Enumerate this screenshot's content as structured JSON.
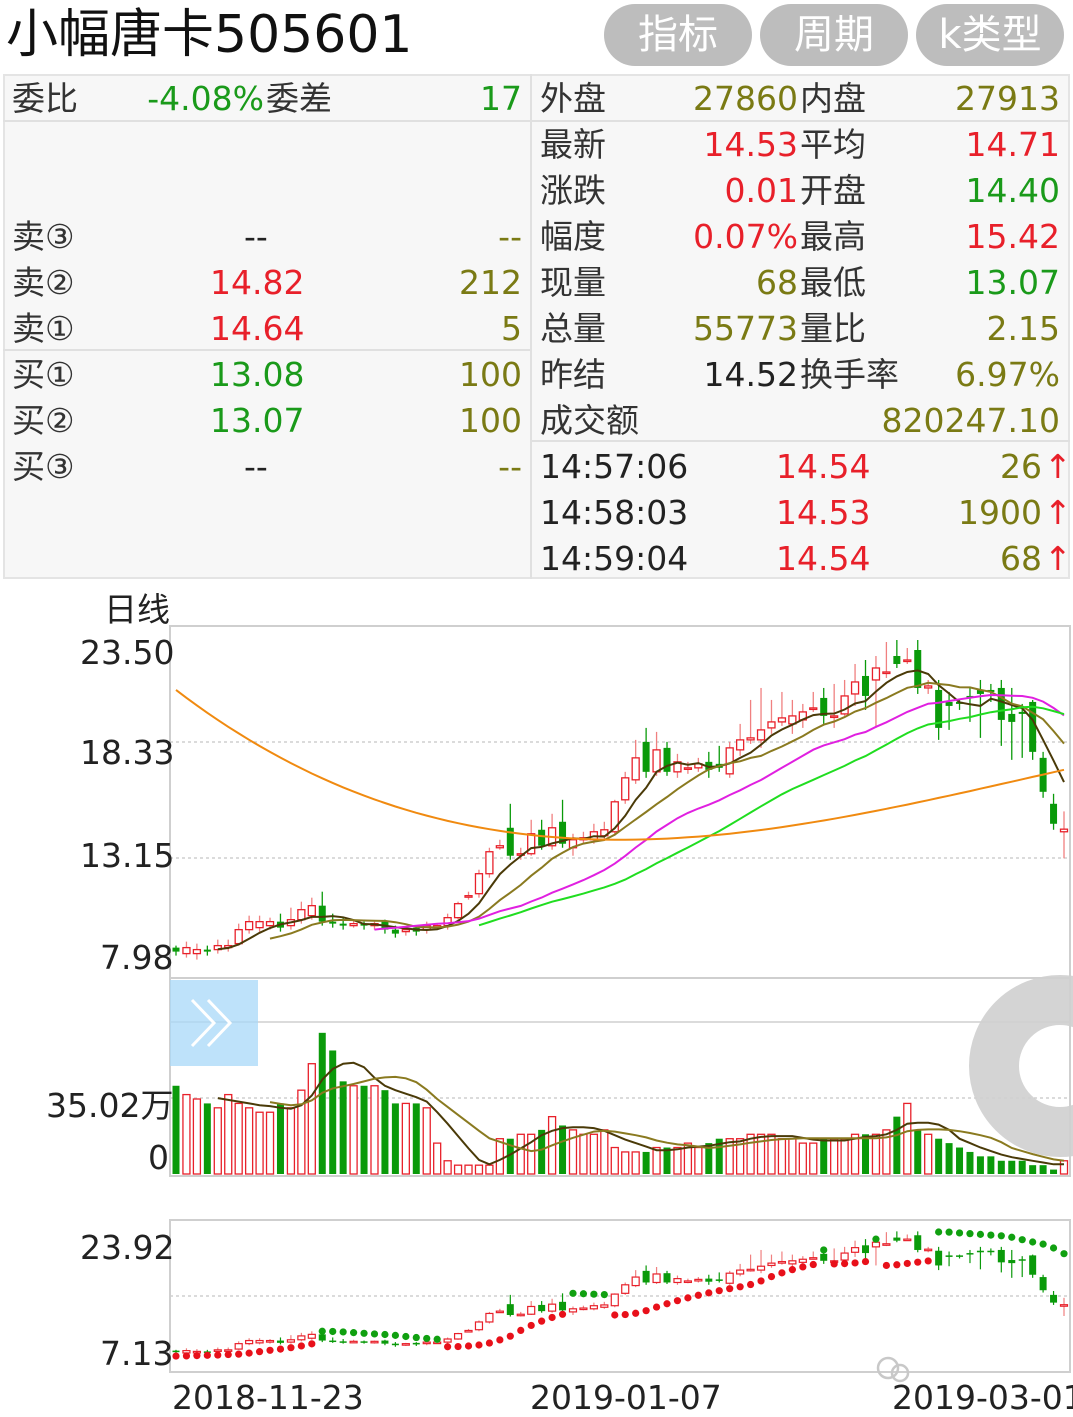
{
  "header": {
    "title": "小幅唐卡505601",
    "buttons": [
      "指标",
      "周期",
      "k类型"
    ]
  },
  "quote": {
    "weibi_label": "委比",
    "weibi_value": "-4.08%",
    "weicha_label": "委差",
    "weicha_value": "17",
    "sell": [
      {
        "label": "卖③",
        "price": "--",
        "volume": "--"
      },
      {
        "label": "卖②",
        "price": "14.82",
        "volume": "212"
      },
      {
        "label": "卖①",
        "price": "14.64",
        "volume": "5"
      }
    ],
    "buy": [
      {
        "label": "买①",
        "price": "13.08",
        "volume": "100"
      },
      {
        "label": "买②",
        "price": "13.07",
        "volume": "100"
      },
      {
        "label": "买③",
        "price": "--",
        "volume": "--"
      }
    ],
    "right": [
      {
        "l1": "外盘",
        "v1": "27860",
        "c1": "olv",
        "l2": "内盘",
        "v2": "27913",
        "c2": "olv"
      },
      {
        "l1": "最新",
        "v1": "14.53",
        "c1": "red",
        "l2": "平均",
        "v2": "14.71",
        "c2": "red"
      },
      {
        "l1": "涨跌",
        "v1": "0.01",
        "c1": "red",
        "l2": "开盘",
        "v2": "14.40",
        "c2": "grn"
      },
      {
        "l1": "幅度",
        "v1": "0.07%",
        "c1": "red",
        "l2": "最高",
        "v2": "15.42",
        "c2": "red"
      },
      {
        "l1": "现量",
        "v1": "68",
        "c1": "olv",
        "l2": "最低",
        "v2": "13.07",
        "c2": "grn"
      },
      {
        "l1": "总量",
        "v1": "55773",
        "c1": "olv",
        "l2": "量比",
        "v2": "2.15",
        "c2": "olv"
      },
      {
        "l1": "昨结",
        "v1": "14.52",
        "c1": "blk",
        "l2": "换手率",
        "v2": "6.97%",
        "c2": "olv"
      }
    ],
    "turnover_label": "成交额",
    "turnover_value": "820247.10",
    "ticks": [
      {
        "time": "14:57:06",
        "price": "14.54",
        "volume": "26",
        "arrow": "↑"
      },
      {
        "time": "14:58:03",
        "price": "14.53",
        "volume": "1900",
        "arrow": "↑"
      },
      {
        "time": "14:59:04",
        "price": "14.54",
        "volume": "68",
        "arrow": "↑"
      }
    ]
  },
  "chart_data": {
    "type": "candlestick",
    "period_label": "日线",
    "price_axis_labels": [
      "23.50",
      "18.33",
      "13.15",
      "7.98"
    ],
    "price_ylim": [
      7.98,
      23.5
    ],
    "volume_axis_labels": [
      "35.02万",
      "0"
    ],
    "sar_axis_labels": [
      "23.92",
      "7.13"
    ],
    "sar_ylim": [
      7.13,
      23.92
    ],
    "x_labels": [
      "2018-11-23",
      "2019-01-07",
      "2019-03-01"
    ],
    "colors": {
      "up": "#e8202a",
      "down": "#0a9a0a",
      "ma5": "#4a3a08",
      "ma10": "#8a7a20",
      "ma20": "#e020e0",
      "ma30": "#20dd20",
      "ma60": "#f08a10"
    },
    "candles": [
      {
        "o": 8.6,
        "c": 8.4,
        "h": 8.7,
        "l": 8.2
      },
      {
        "o": 8.3,
        "c": 8.6,
        "h": 8.9,
        "l": 8.1
      },
      {
        "o": 8.3,
        "c": 8.5,
        "h": 8.8,
        "l": 8.0
      },
      {
        "o": 8.5,
        "c": 8.4,
        "h": 8.7,
        "l": 8.2
      },
      {
        "o": 8.5,
        "c": 8.7,
        "h": 9.0,
        "l": 8.3
      },
      {
        "o": 8.6,
        "c": 8.7,
        "h": 9.0,
        "l": 8.4
      },
      {
        "o": 8.8,
        "c": 9.5,
        "h": 9.8,
        "l": 8.7
      },
      {
        "o": 9.5,
        "c": 9.9,
        "h": 10.2,
        "l": 9.3
      },
      {
        "o": 9.6,
        "c": 9.9,
        "h": 10.2,
        "l": 9.4
      },
      {
        "o": 9.7,
        "c": 9.9,
        "h": 10.1,
        "l": 9.5
      },
      {
        "o": 9.9,
        "c": 9.6,
        "h": 10.3,
        "l": 9.4
      },
      {
        "o": 9.7,
        "c": 10.0,
        "h": 10.6,
        "l": 9.5
      },
      {
        "o": 10.0,
        "c": 10.5,
        "h": 10.9,
        "l": 9.8
      },
      {
        "o": 10.2,
        "c": 10.7,
        "h": 11.1,
        "l": 10.0
      },
      {
        "o": 10.7,
        "c": 9.9,
        "h": 11.4,
        "l": 9.7
      },
      {
        "o": 9.9,
        "c": 9.8,
        "h": 10.3,
        "l": 9.6
      },
      {
        "o": 9.8,
        "c": 9.7,
        "h": 10.1,
        "l": 9.5
      },
      {
        "o": 9.7,
        "c": 9.8,
        "h": 10.0,
        "l": 9.6
      },
      {
        "o": 9.8,
        "c": 9.7,
        "h": 9.9,
        "l": 9.5
      },
      {
        "o": 9.7,
        "c": 9.8,
        "h": 9.9,
        "l": 9.5
      },
      {
        "o": 9.9,
        "c": 9.5,
        "h": 10.0,
        "l": 9.3
      },
      {
        "o": 9.5,
        "c": 9.3,
        "h": 9.7,
        "l": 9.1
      },
      {
        "o": 9.4,
        "c": 9.5,
        "h": 9.6,
        "l": 9.2
      },
      {
        "o": 9.6,
        "c": 9.4,
        "h": 9.7,
        "l": 9.2
      },
      {
        "o": 9.5,
        "c": 9.7,
        "h": 9.9,
        "l": 9.3
      },
      {
        "o": 9.7,
        "c": 9.7,
        "h": 9.8,
        "l": 9.5
      },
      {
        "o": 9.7,
        "c": 10.1,
        "h": 10.3,
        "l": 9.5
      },
      {
        "o": 10.1,
        "c": 10.8,
        "h": 10.9,
        "l": 10.0
      },
      {
        "o": 11.2,
        "c": 11.2,
        "h": 11.4,
        "l": 11.0
      },
      {
        "o": 11.3,
        "c": 12.3,
        "h": 12.5,
        "l": 11.1
      },
      {
        "o": 12.3,
        "c": 13.4,
        "h": 13.6,
        "l": 12.1
      },
      {
        "o": 13.6,
        "c": 13.7,
        "h": 14.0,
        "l": 13.5
      },
      {
        "o": 14.6,
        "c": 13.2,
        "h": 15.8,
        "l": 13.0
      },
      {
        "o": 13.3,
        "c": 13.3,
        "h": 13.6,
        "l": 13.0
      },
      {
        "o": 13.3,
        "c": 14.3,
        "h": 15.0,
        "l": 13.2
      },
      {
        "o": 14.5,
        "c": 13.7,
        "h": 15.0,
        "l": 13.5
      },
      {
        "o": 13.7,
        "c": 14.6,
        "h": 15.3,
        "l": 13.5
      },
      {
        "o": 14.9,
        "c": 13.8,
        "h": 16.0,
        "l": 13.6
      },
      {
        "o": 13.6,
        "c": 14.0,
        "h": 14.3,
        "l": 13.2
      },
      {
        "o": 14.0,
        "c": 14.1,
        "h": 14.4,
        "l": 13.8
      },
      {
        "o": 14.0,
        "c": 14.4,
        "h": 14.8,
        "l": 13.8
      },
      {
        "o": 14.2,
        "c": 14.5,
        "h": 14.9,
        "l": 14.0
      },
      {
        "o": 14.4,
        "c": 15.9,
        "h": 16.0,
        "l": 14.2
      },
      {
        "o": 16.0,
        "c": 17.1,
        "h": 17.4,
        "l": 15.8
      },
      {
        "o": 17.0,
        "c": 18.1,
        "h": 19.0,
        "l": 16.8
      },
      {
        "o": 18.9,
        "c": 17.4,
        "h": 19.6,
        "l": 17.1
      },
      {
        "o": 17.4,
        "c": 18.5,
        "h": 19.4,
        "l": 17.2
      },
      {
        "o": 18.6,
        "c": 17.4,
        "h": 18.9,
        "l": 17.2
      },
      {
        "o": 17.4,
        "c": 17.9,
        "h": 18.3,
        "l": 17.1
      },
      {
        "o": 17.6,
        "c": 17.6,
        "h": 17.9,
        "l": 17.3
      },
      {
        "o": 17.6,
        "c": 17.8,
        "h": 18.1,
        "l": 17.4
      },
      {
        "o": 17.9,
        "c": 17.5,
        "h": 18.4,
        "l": 17.1
      },
      {
        "o": 17.8,
        "c": 17.6,
        "h": 18.7,
        "l": 17.4
      },
      {
        "o": 17.3,
        "c": 18.6,
        "h": 18.9,
        "l": 17.1
      },
      {
        "o": 18.5,
        "c": 19.0,
        "h": 19.8,
        "l": 18.2
      },
      {
        "o": 19.0,
        "c": 19.1,
        "h": 21.0,
        "l": 18.8
      },
      {
        "o": 19.0,
        "c": 19.5,
        "h": 21.6,
        "l": 18.6
      },
      {
        "o": 19.6,
        "c": 19.9,
        "h": 21.0,
        "l": 19.3
      },
      {
        "o": 19.9,
        "c": 20.1,
        "h": 21.4,
        "l": 19.7
      },
      {
        "o": 19.8,
        "c": 20.2,
        "h": 21.0,
        "l": 19.3
      },
      {
        "o": 20.0,
        "c": 20.4,
        "h": 20.8,
        "l": 19.6
      },
      {
        "o": 20.6,
        "c": 20.6,
        "h": 21.4,
        "l": 20.4
      },
      {
        "o": 21.1,
        "c": 20.2,
        "h": 21.6,
        "l": 19.8
      },
      {
        "o": 20.2,
        "c": 20.2,
        "h": 21.8,
        "l": 19.6
      },
      {
        "o": 20.3,
        "c": 21.2,
        "h": 22.0,
        "l": 20.2
      },
      {
        "o": 21.3,
        "c": 21.9,
        "h": 22.8,
        "l": 20.7
      },
      {
        "o": 22.2,
        "c": 21.2,
        "h": 23.0,
        "l": 20.5
      },
      {
        "o": 22.0,
        "c": 22.6,
        "h": 23.2,
        "l": 19.6
      },
      {
        "o": 22.4,
        "c": 22.4,
        "h": 23.9,
        "l": 22.1
      },
      {
        "o": 23.2,
        "c": 22.8,
        "h": 24.0,
        "l": 22.6
      },
      {
        "o": 23.0,
        "c": 23.0,
        "h": 23.6,
        "l": 22.8
      },
      {
        "o": 23.5,
        "c": 21.6,
        "h": 24.0,
        "l": 21.3
      },
      {
        "o": 21.6,
        "c": 21.7,
        "h": 22.0,
        "l": 21.3
      },
      {
        "o": 21.5,
        "c": 19.6,
        "h": 22.0,
        "l": 19.0
      },
      {
        "o": 20.9,
        "c": 20.7,
        "h": 21.4,
        "l": 19.5
      },
      {
        "o": 20.9,
        "c": 20.8,
        "h": 21.0,
        "l": 20.5
      },
      {
        "o": 21.2,
        "c": 21.1,
        "h": 21.6,
        "l": 19.9
      },
      {
        "o": 21.5,
        "c": 21.3,
        "h": 22.0,
        "l": 19.1
      },
      {
        "o": 21.5,
        "c": 21.4,
        "h": 21.8,
        "l": 20.9
      },
      {
        "o": 21.6,
        "c": 20.0,
        "h": 22.0,
        "l": 18.7
      },
      {
        "o": 20.3,
        "c": 19.9,
        "h": 21.6,
        "l": 18.0
      },
      {
        "o": 20.4,
        "c": 20.3,
        "h": 20.8,
        "l": 18.1
      },
      {
        "o": 20.9,
        "c": 18.4,
        "h": 21.0,
        "l": 18.0
      },
      {
        "o": 18.1,
        "c": 16.4,
        "h": 18.4,
        "l": 16.1
      },
      {
        "o": 15.8,
        "c": 14.8,
        "h": 16.3,
        "l": 14.5
      },
      {
        "o": 14.4,
        "c": 14.53,
        "h": 15.42,
        "l": 13.07
      }
    ],
    "volumes": [
      2.0,
      1.8,
      1.7,
      1.6,
      1.5,
      1.8,
      1.6,
      1.5,
      1.4,
      1.4,
      1.6,
      1.5,
      1.9,
      2.5,
      3.2,
      2.8,
      2.1,
      2.0,
      2.0,
      2.0,
      1.9,
      1.6,
      1.6,
      1.6,
      1.5,
      0.7,
      0.3,
      0.2,
      0.2,
      0.2,
      0.2,
      0.8,
      0.8,
      0.9,
      0.9,
      1.0,
      1.3,
      1.1,
      1.0,
      0.9,
      0.9,
      1.0,
      0.6,
      0.5,
      0.5,
      0.5,
      0.6,
      0.6,
      0.6,
      0.7,
      0.6,
      0.7,
      0.8,
      0.8,
      0.8,
      0.9,
      0.9,
      0.9,
      0.8,
      0.8,
      0.7,
      0.7,
      0.8,
      0.8,
      0.8,
      0.9,
      0.9,
      0.9,
      1.0,
      1.3,
      1.6,
      1.0,
      0.9,
      0.8,
      0.7,
      0.6,
      0.5,
      0.4,
      0.4,
      0.3,
      0.3,
      0.3,
      0.2,
      0.2,
      0.1,
      0.3
    ]
  }
}
